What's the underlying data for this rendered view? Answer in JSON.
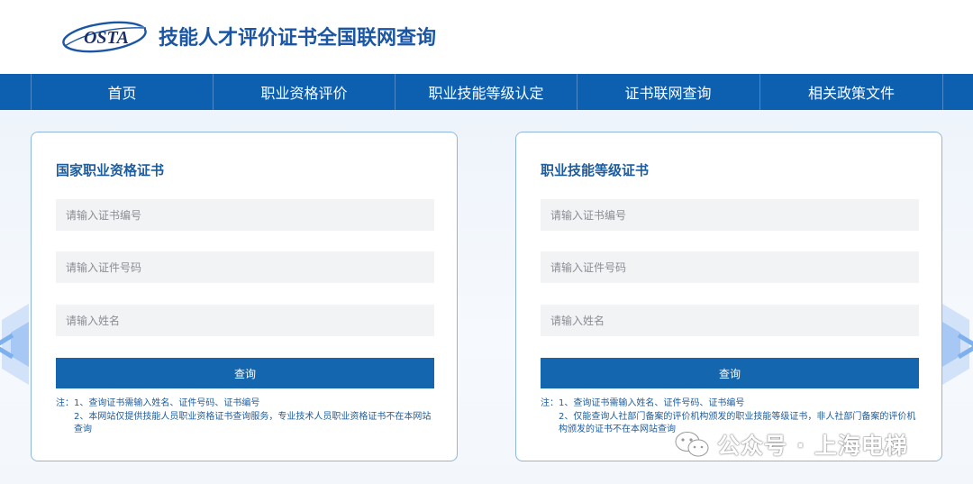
{
  "header": {
    "logo_text": "OSTA",
    "title": "技能人才评价证书全国联网查询"
  },
  "nav": {
    "items": [
      {
        "label": "首页"
      },
      {
        "label": "职业资格评价"
      },
      {
        "label": "职业技能等级认定"
      },
      {
        "label": "证书联网查询"
      },
      {
        "label": "相关政策文件"
      }
    ]
  },
  "cards": [
    {
      "title": "国家职业资格证书",
      "fields": {
        "cert_no_placeholder": "请输入证书编号",
        "id_no_placeholder": "请输入证件号码",
        "name_placeholder": "请输入姓名"
      },
      "button_label": "查询",
      "note_prefix": "注：",
      "notes": [
        {
          "text": "1、查询证书需输入姓名、证件号码、证书编号"
        },
        {
          "text": "2、本网站仅提供技能人员职业资格证书查询服务，专业技术人员职业资格证书不在本网站查询"
        }
      ]
    },
    {
      "title": "职业技能等级证书",
      "fields": {
        "cert_no_placeholder": "请输入证书编号",
        "id_no_placeholder": "请输入证件号码",
        "name_placeholder": "请输入姓名"
      },
      "button_label": "查询",
      "note_prefix": "注：",
      "notes": [
        {
          "text": "1、查询证书需输入姓名、证件号码、证书编号"
        },
        {
          "text": "2、仅能查询人社部门备案的评价机构颁发的职业技能等级证书，非人社部门备案的评价机构颁发的证书不在本网站查询"
        }
      ]
    }
  ],
  "watermark": {
    "text": "公众号 · 上海电梯",
    "icon": "wechat-icon"
  },
  "colors": {
    "brand_blue": "#0d5fb0",
    "button_blue": "#1466ae",
    "title_blue": "#1d5c9d",
    "field_bg": "#f2f3f5"
  }
}
